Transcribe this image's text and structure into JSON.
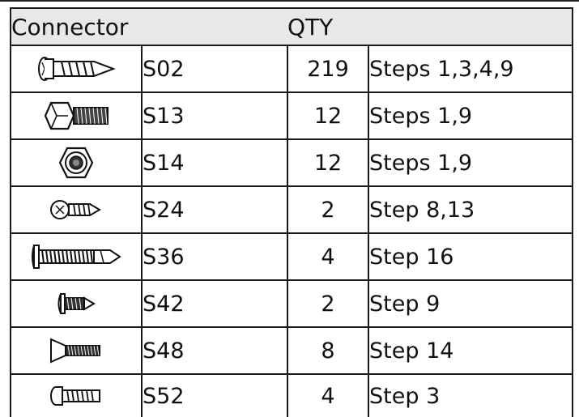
{
  "header": {
    "connector": "Connector",
    "qty": "QTY"
  },
  "rows": [
    {
      "icon": "tapping-screw-icon",
      "code": "S02",
      "qty": "219",
      "steps": "Steps 1,3,4,9"
    },
    {
      "icon": "hex-bolt-icon",
      "code": "S13",
      "qty": "12",
      "steps": "Steps 1,9"
    },
    {
      "icon": "hex-nut-icon",
      "code": "S14",
      "qty": "12",
      "steps": "Steps 1,9"
    },
    {
      "icon": "phillips-screw-icon",
      "code": "S24",
      "qty": "2",
      "steps": "Step 8,13"
    },
    {
      "icon": "long-self-drilling-screw-icon",
      "code": "S36",
      "qty": "4",
      "steps": "Step 16"
    },
    {
      "icon": "short-pan-screw-icon",
      "code": "S42",
      "qty": "2",
      "steps": "Step 9"
    },
    {
      "icon": "countersunk-screw-icon",
      "code": "S48",
      "qty": "8",
      "steps": "Step 14"
    },
    {
      "icon": "round-head-screw-icon",
      "code": "S52",
      "qty": "4",
      "steps": "Step 3"
    }
  ]
}
